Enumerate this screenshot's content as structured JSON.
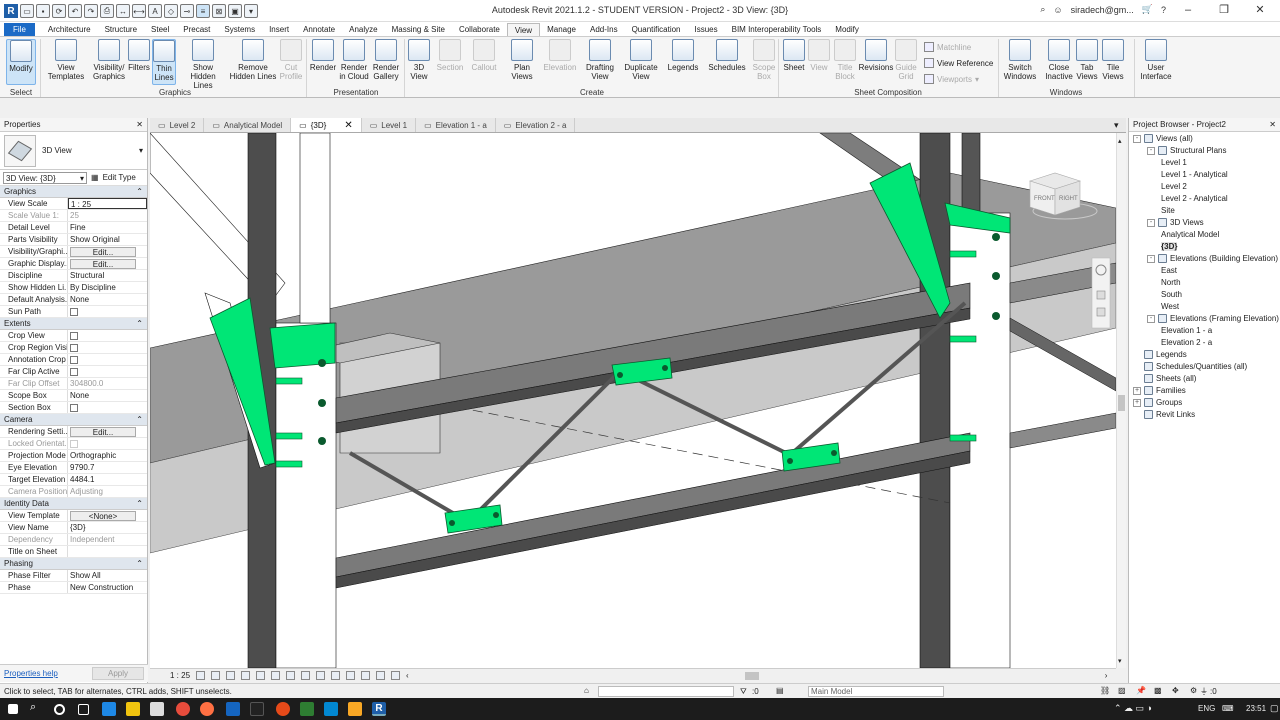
{
  "window": {
    "title": "Autodesk Revit 2021.1.2 - STUDENT VERSION - Project2 - 3D View: {3D}",
    "user": "siradech@gm...",
    "help": "?"
  },
  "menu": {
    "tabs": [
      "File",
      "Architecture",
      "Structure",
      "Steel",
      "Precast",
      "Systems",
      "Insert",
      "Annotate",
      "Analyze",
      "Massing & Site",
      "Collaborate",
      "View",
      "Manage",
      "Add-Ins",
      "Quantification",
      "Issues",
      "BIM Interoperability Tools",
      "Modify"
    ],
    "active": "View"
  },
  "ribbon": {
    "select": {
      "modify": "Modify",
      "panel": "Select"
    },
    "graphics": {
      "view_templates": "View Templates",
      "visibility_graphics": "Visibility/ Graphics",
      "filters": "Filters",
      "thin_lines": "Thin Lines",
      "show_hidden": "Show Hidden Lines",
      "remove_hidden": "Remove Hidden Lines",
      "cut_profile": "Cut Profile",
      "panel": "Graphics"
    },
    "presentation": {
      "render": "Render",
      "render_cloud": "Render in Cloud",
      "render_gallery": "Render Gallery",
      "panel": "Presentation"
    },
    "create": {
      "view3d": "3D View",
      "section": "Section",
      "callout": "Callout",
      "plan_views": "Plan Views",
      "elevation": "Elevation",
      "drafting_view": "Drafting View",
      "duplicate_view": "Duplicate View",
      "legends": "Legends",
      "schedules": "Schedules",
      "scope_box": "Scope Box",
      "panel": "Create"
    },
    "sheet": {
      "sheet": "Sheet",
      "view": "View",
      "title_block": "Title Block",
      "revisions": "Revisions",
      "guide_grid": "Guide Grid",
      "matchline": "Matchline",
      "view_reference": "View Reference",
      "viewports": "Viewports",
      "panel": "Sheet Composition"
    },
    "windows": {
      "switch": "Switch Windows",
      "close_inactive": "Close Inactive",
      "tab_views": "Tab Views",
      "tile_views": "Tile Views",
      "panel": "Windows"
    },
    "ui": {
      "user_interface": "User Interface"
    }
  },
  "properties": {
    "title": "Properties",
    "type_name": "3D View",
    "instance_filter": "3D View: {3D}",
    "edit_type": "Edit Type",
    "groups": [
      {
        "name": "Graphics",
        "rows": [
          {
            "k": "View Scale",
            "v": "1 : 25",
            "kind": "box"
          },
          {
            "k": "Scale Value    1:",
            "v": "25",
            "kind": "ro"
          },
          {
            "k": "Detail Level",
            "v": "Fine"
          },
          {
            "k": "Parts Visibility",
            "v": "Show Original"
          },
          {
            "k": "Visibility/Graphi...",
            "v": "Edit...",
            "kind": "btn"
          },
          {
            "k": "Graphic Display...",
            "v": "Edit...",
            "kind": "btn"
          },
          {
            "k": "Discipline",
            "v": "Structural"
          },
          {
            "k": "Show Hidden Li...",
            "v": "By Discipline"
          },
          {
            "k": "Default Analysis...",
            "v": "None"
          },
          {
            "k": "Sun Path",
            "v": "",
            "kind": "cb"
          }
        ]
      },
      {
        "name": "Extents",
        "rows": [
          {
            "k": "Crop View",
            "v": "",
            "kind": "cb"
          },
          {
            "k": "Crop Region Visi...",
            "v": "",
            "kind": "cb"
          },
          {
            "k": "Annotation Crop",
            "v": "",
            "kind": "cb"
          },
          {
            "k": "Far Clip Active",
            "v": "",
            "kind": "cb"
          },
          {
            "k": "Far Clip Offset",
            "v": "304800.0",
            "kind": "ro"
          },
          {
            "k": "Scope Box",
            "v": "None"
          },
          {
            "k": "Section Box",
            "v": "",
            "kind": "cb"
          }
        ]
      },
      {
        "name": "Camera",
        "rows": [
          {
            "k": "Rendering Setti...",
            "v": "Edit...",
            "kind": "btn"
          },
          {
            "k": "Locked Orientat...",
            "v": "",
            "kind": "cbro"
          },
          {
            "k": "Projection Mode",
            "v": "Orthographic"
          },
          {
            "k": "Eye Elevation",
            "v": "9790.7"
          },
          {
            "k": "Target Elevation",
            "v": "4484.1"
          },
          {
            "k": "Camera Position",
            "v": "Adjusting",
            "kind": "ro"
          }
        ]
      },
      {
        "name": "Identity Data",
        "rows": [
          {
            "k": "View Template",
            "v": "<None>",
            "kind": "btn"
          },
          {
            "k": "View Name",
            "v": "{3D}"
          },
          {
            "k": "Dependency",
            "v": "Independent",
            "kind": "ro"
          },
          {
            "k": "Title on Sheet",
            "v": ""
          }
        ]
      },
      {
        "name": "Phasing",
        "rows": [
          {
            "k": "Phase Filter",
            "v": "Show All"
          },
          {
            "k": "Phase",
            "v": "New Construction"
          }
        ]
      }
    ],
    "help_link": "Properties help",
    "apply": "Apply"
  },
  "view_tabs": [
    {
      "label": "Level 2",
      "active": false
    },
    {
      "label": "Analytical Model",
      "active": false
    },
    {
      "label": "{3D}",
      "active": true
    },
    {
      "label": "Level 1",
      "active": false
    },
    {
      "label": "Elevation 1 - a",
      "active": false
    },
    {
      "label": "Elevation 2 - a",
      "active": false
    }
  ],
  "viewcube": {
    "front": "FRONT",
    "right": "RIGHT"
  },
  "view_bar": {
    "scale": "1 : 25"
  },
  "browser": {
    "title": "Project Browser - Project2",
    "nodes": [
      {
        "label": "Views (all)",
        "level": 0,
        "tog": "-"
      },
      {
        "label": "Structural Plans",
        "level": 1,
        "tog": "-"
      },
      {
        "label": "Level 1",
        "level": 2
      },
      {
        "label": "Level 1 - Analytical",
        "level": 2
      },
      {
        "label": "Level 2",
        "level": 2
      },
      {
        "label": "Level 2 - Analytical",
        "level": 2
      },
      {
        "label": "Site",
        "level": 2
      },
      {
        "label": "3D Views",
        "level": 1,
        "tog": "-"
      },
      {
        "label": "Analytical Model",
        "level": 2
      },
      {
        "label": "{3D}",
        "level": 2,
        "bold": true
      },
      {
        "label": "Elevations (Building Elevation)",
        "level": 1,
        "tog": "-"
      },
      {
        "label": "East",
        "level": 2
      },
      {
        "label": "North",
        "level": 2
      },
      {
        "label": "South",
        "level": 2
      },
      {
        "label": "West",
        "level": 2
      },
      {
        "label": "Elevations (Framing Elevation)",
        "level": 1,
        "tog": "-"
      },
      {
        "label": "Elevation 1 - a",
        "level": 2
      },
      {
        "label": "Elevation 2 - a",
        "level": 2
      },
      {
        "label": "Legends",
        "level": 0,
        "tog": ""
      },
      {
        "label": "Schedules/Quantities (all)",
        "level": 0,
        "tog": ""
      },
      {
        "label": "Sheets (all)",
        "level": 0,
        "tog": ""
      },
      {
        "label": "Families",
        "level": 0,
        "tog": "+"
      },
      {
        "label": "Groups",
        "level": 0,
        "tog": "+"
      },
      {
        "label": "Revit Links",
        "level": 0,
        "tog": ""
      }
    ]
  },
  "status": {
    "hint": "Click to select, TAB for alternates, CTRL adds, SHIFT unselects.",
    "workset_count": ":0",
    "model": "Main Model",
    "filter_count": ":0"
  },
  "taskbar": {
    "lang": "ENG",
    "time": "23:51"
  },
  "colors": {
    "steel_connection": "#00e676",
    "accent": "#1b6ac6",
    "beam_top": "#8c8c8c",
    "beam_side": "#5a5a5a"
  }
}
